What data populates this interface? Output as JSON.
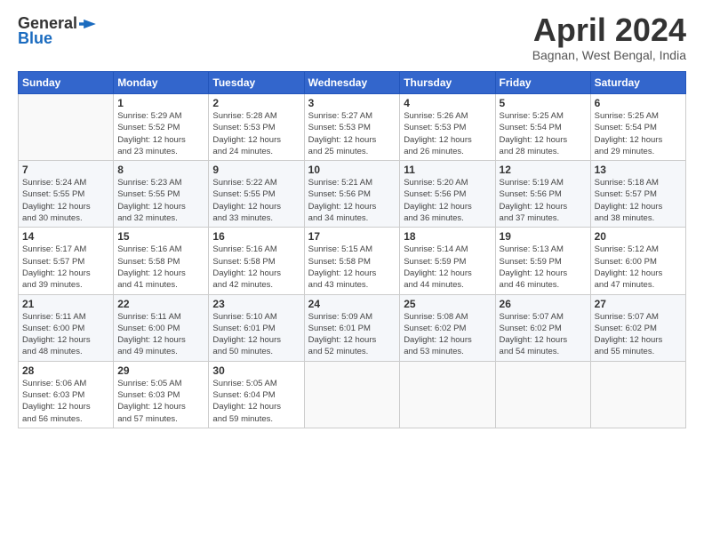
{
  "header": {
    "logo_line1": "General",
    "logo_line2": "Blue",
    "month_title": "April 2024",
    "location": "Bagnan, West Bengal, India"
  },
  "calendar": {
    "headers": [
      "Sunday",
      "Monday",
      "Tuesday",
      "Wednesday",
      "Thursday",
      "Friday",
      "Saturday"
    ],
    "weeks": [
      [
        {
          "day": "",
          "info": ""
        },
        {
          "day": "1",
          "info": "Sunrise: 5:29 AM\nSunset: 5:52 PM\nDaylight: 12 hours\nand 23 minutes."
        },
        {
          "day": "2",
          "info": "Sunrise: 5:28 AM\nSunset: 5:53 PM\nDaylight: 12 hours\nand 24 minutes."
        },
        {
          "day": "3",
          "info": "Sunrise: 5:27 AM\nSunset: 5:53 PM\nDaylight: 12 hours\nand 25 minutes."
        },
        {
          "day": "4",
          "info": "Sunrise: 5:26 AM\nSunset: 5:53 PM\nDaylight: 12 hours\nand 26 minutes."
        },
        {
          "day": "5",
          "info": "Sunrise: 5:25 AM\nSunset: 5:54 PM\nDaylight: 12 hours\nand 28 minutes."
        },
        {
          "day": "6",
          "info": "Sunrise: 5:25 AM\nSunset: 5:54 PM\nDaylight: 12 hours\nand 29 minutes."
        }
      ],
      [
        {
          "day": "7",
          "info": "Sunrise: 5:24 AM\nSunset: 5:55 PM\nDaylight: 12 hours\nand 30 minutes."
        },
        {
          "day": "8",
          "info": "Sunrise: 5:23 AM\nSunset: 5:55 PM\nDaylight: 12 hours\nand 32 minutes."
        },
        {
          "day": "9",
          "info": "Sunrise: 5:22 AM\nSunset: 5:55 PM\nDaylight: 12 hours\nand 33 minutes."
        },
        {
          "day": "10",
          "info": "Sunrise: 5:21 AM\nSunset: 5:56 PM\nDaylight: 12 hours\nand 34 minutes."
        },
        {
          "day": "11",
          "info": "Sunrise: 5:20 AM\nSunset: 5:56 PM\nDaylight: 12 hours\nand 36 minutes."
        },
        {
          "day": "12",
          "info": "Sunrise: 5:19 AM\nSunset: 5:56 PM\nDaylight: 12 hours\nand 37 minutes."
        },
        {
          "day": "13",
          "info": "Sunrise: 5:18 AM\nSunset: 5:57 PM\nDaylight: 12 hours\nand 38 minutes."
        }
      ],
      [
        {
          "day": "14",
          "info": "Sunrise: 5:17 AM\nSunset: 5:57 PM\nDaylight: 12 hours\nand 39 minutes."
        },
        {
          "day": "15",
          "info": "Sunrise: 5:16 AM\nSunset: 5:58 PM\nDaylight: 12 hours\nand 41 minutes."
        },
        {
          "day": "16",
          "info": "Sunrise: 5:16 AM\nSunset: 5:58 PM\nDaylight: 12 hours\nand 42 minutes."
        },
        {
          "day": "17",
          "info": "Sunrise: 5:15 AM\nSunset: 5:58 PM\nDaylight: 12 hours\nand 43 minutes."
        },
        {
          "day": "18",
          "info": "Sunrise: 5:14 AM\nSunset: 5:59 PM\nDaylight: 12 hours\nand 44 minutes."
        },
        {
          "day": "19",
          "info": "Sunrise: 5:13 AM\nSunset: 5:59 PM\nDaylight: 12 hours\nand 46 minutes."
        },
        {
          "day": "20",
          "info": "Sunrise: 5:12 AM\nSunset: 6:00 PM\nDaylight: 12 hours\nand 47 minutes."
        }
      ],
      [
        {
          "day": "21",
          "info": "Sunrise: 5:11 AM\nSunset: 6:00 PM\nDaylight: 12 hours\nand 48 minutes."
        },
        {
          "day": "22",
          "info": "Sunrise: 5:11 AM\nSunset: 6:00 PM\nDaylight: 12 hours\nand 49 minutes."
        },
        {
          "day": "23",
          "info": "Sunrise: 5:10 AM\nSunset: 6:01 PM\nDaylight: 12 hours\nand 50 minutes."
        },
        {
          "day": "24",
          "info": "Sunrise: 5:09 AM\nSunset: 6:01 PM\nDaylight: 12 hours\nand 52 minutes."
        },
        {
          "day": "25",
          "info": "Sunrise: 5:08 AM\nSunset: 6:02 PM\nDaylight: 12 hours\nand 53 minutes."
        },
        {
          "day": "26",
          "info": "Sunrise: 5:07 AM\nSunset: 6:02 PM\nDaylight: 12 hours\nand 54 minutes."
        },
        {
          "day": "27",
          "info": "Sunrise: 5:07 AM\nSunset: 6:02 PM\nDaylight: 12 hours\nand 55 minutes."
        }
      ],
      [
        {
          "day": "28",
          "info": "Sunrise: 5:06 AM\nSunset: 6:03 PM\nDaylight: 12 hours\nand 56 minutes."
        },
        {
          "day": "29",
          "info": "Sunrise: 5:05 AM\nSunset: 6:03 PM\nDaylight: 12 hours\nand 57 minutes."
        },
        {
          "day": "30",
          "info": "Sunrise: 5:05 AM\nSunset: 6:04 PM\nDaylight: 12 hours\nand 59 minutes."
        },
        {
          "day": "",
          "info": ""
        },
        {
          "day": "",
          "info": ""
        },
        {
          "day": "",
          "info": ""
        },
        {
          "day": "",
          "info": ""
        }
      ]
    ]
  }
}
